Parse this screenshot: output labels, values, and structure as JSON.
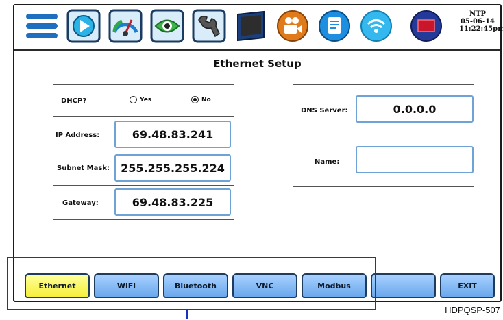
{
  "toolbar": {
    "icons": [
      "menu-icon",
      "play-icon",
      "gauge-icon",
      "eye-icon",
      "wrench-icon",
      "monitor-icon",
      "camera-icon",
      "document-icon",
      "wifi-icon",
      "screen-icon"
    ],
    "clock": {
      "line1": "NTP",
      "line2": "05-06-14",
      "line3": "11:22:45pm"
    }
  },
  "page": {
    "title": "Ethernet Setup"
  },
  "form": {
    "dhcp_label": "DHCP?",
    "dhcp_yes": "Yes",
    "dhcp_no": "No",
    "dhcp_selected": "No",
    "ip_label": "IP Address:",
    "ip_value": "69.48.83.241",
    "subnet_label": "Subnet Mask:",
    "subnet_value": "255.255.255.224",
    "gateway_label": "Gateway:",
    "gateway_value": "69.48.83.225",
    "dns_label": "DNS Server:",
    "dns_value": "0.0.0.0",
    "name_label": "Name:",
    "name_value": ""
  },
  "tabs": [
    {
      "label": "Ethernet",
      "active": true
    },
    {
      "label": "WiFi",
      "active": false
    },
    {
      "label": "Bluetooth",
      "active": false
    },
    {
      "label": "VNC",
      "active": false
    },
    {
      "label": "Modbus",
      "active": false
    },
    {
      "label": "",
      "active": false
    },
    {
      "label": "EXIT",
      "active": false
    }
  ],
  "figure_code": "HDPQSP-507",
  "colors": {
    "tab_blue": "#6aa8ec",
    "tab_active": "#f6ef3a",
    "field_border": "#6fa3d6",
    "callout": "#1532c0"
  }
}
